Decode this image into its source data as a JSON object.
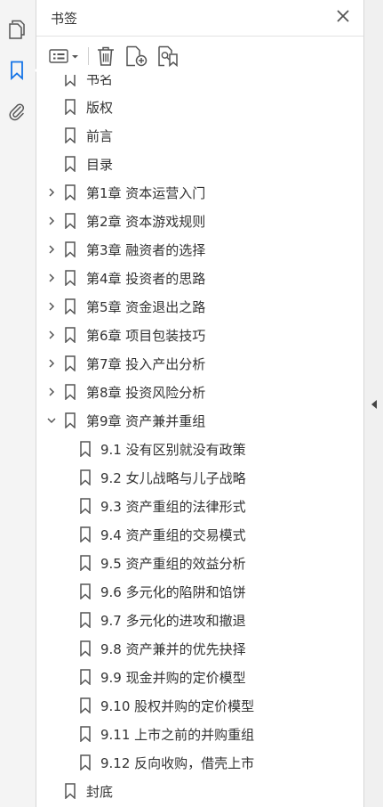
{
  "panel": {
    "title": "书签"
  },
  "bookmarks": [
    {
      "label": "书名",
      "level": 0,
      "chevron": "none"
    },
    {
      "label": "版权",
      "level": 0,
      "chevron": "none"
    },
    {
      "label": "前言",
      "level": 0,
      "chevron": "none"
    },
    {
      "label": "目录",
      "level": 0,
      "chevron": "none"
    },
    {
      "label": "第1章  资本运营入门",
      "level": 0,
      "chevron": "collapsed"
    },
    {
      "label": "第2章  资本游戏规则",
      "level": 0,
      "chevron": "collapsed"
    },
    {
      "label": "第3章  融资者的选择",
      "level": 0,
      "chevron": "collapsed"
    },
    {
      "label": "第4章  投资者的思路",
      "level": 0,
      "chevron": "collapsed"
    },
    {
      "label": "第5章  资金退出之路",
      "level": 0,
      "chevron": "collapsed"
    },
    {
      "label": "第6章  项目包装技巧",
      "level": 0,
      "chevron": "collapsed"
    },
    {
      "label": "第7章  投入产出分析",
      "level": 0,
      "chevron": "collapsed"
    },
    {
      "label": "第8章  投资风险分析",
      "level": 0,
      "chevron": "collapsed"
    },
    {
      "label": "第9章  资产兼并重组",
      "level": 0,
      "chevron": "expanded"
    },
    {
      "label": "9.1  没有区别就没有政策",
      "level": 1,
      "chevron": "none"
    },
    {
      "label": "9.2  女儿战略与儿子战略",
      "level": 1,
      "chevron": "none"
    },
    {
      "label": "9.3  资产重组的法律形式",
      "level": 1,
      "chevron": "none"
    },
    {
      "label": "9.4  资产重组的交易模式",
      "level": 1,
      "chevron": "none"
    },
    {
      "label": "9.5  资产重组的效益分析",
      "level": 1,
      "chevron": "none"
    },
    {
      "label": "9.6  多元化的陷阱和馅饼",
      "level": 1,
      "chevron": "none"
    },
    {
      "label": "9.7  多元化的进攻和撤退",
      "level": 1,
      "chevron": "none"
    },
    {
      "label": "9.8  资产兼并的优先抉择",
      "level": 1,
      "chevron": "none"
    },
    {
      "label": "9.9  现金并购的定价模型",
      "level": 1,
      "chevron": "none"
    },
    {
      "label": "9.10  股权并购的定价模型",
      "level": 1,
      "chevron": "none"
    },
    {
      "label": "9.11  上市之前的并购重组",
      "level": 1,
      "chevron": "none"
    },
    {
      "label": "9.12  反向收购，借壳上市",
      "level": 1,
      "chevron": "none"
    },
    {
      "label": "封底",
      "level": 0,
      "chevron": "none"
    }
  ],
  "icons": {
    "rail": [
      "pages-icon",
      "bookmark-icon",
      "attachment-icon"
    ],
    "toolbar": [
      "options-menu-icon",
      "delete-icon",
      "new-bookmark-icon",
      "bookmark-from-selection-icon"
    ]
  },
  "colors": {
    "accent": "#1473e6",
    "icon": "#555555",
    "scroll_thumb": "#c8c8c8"
  }
}
